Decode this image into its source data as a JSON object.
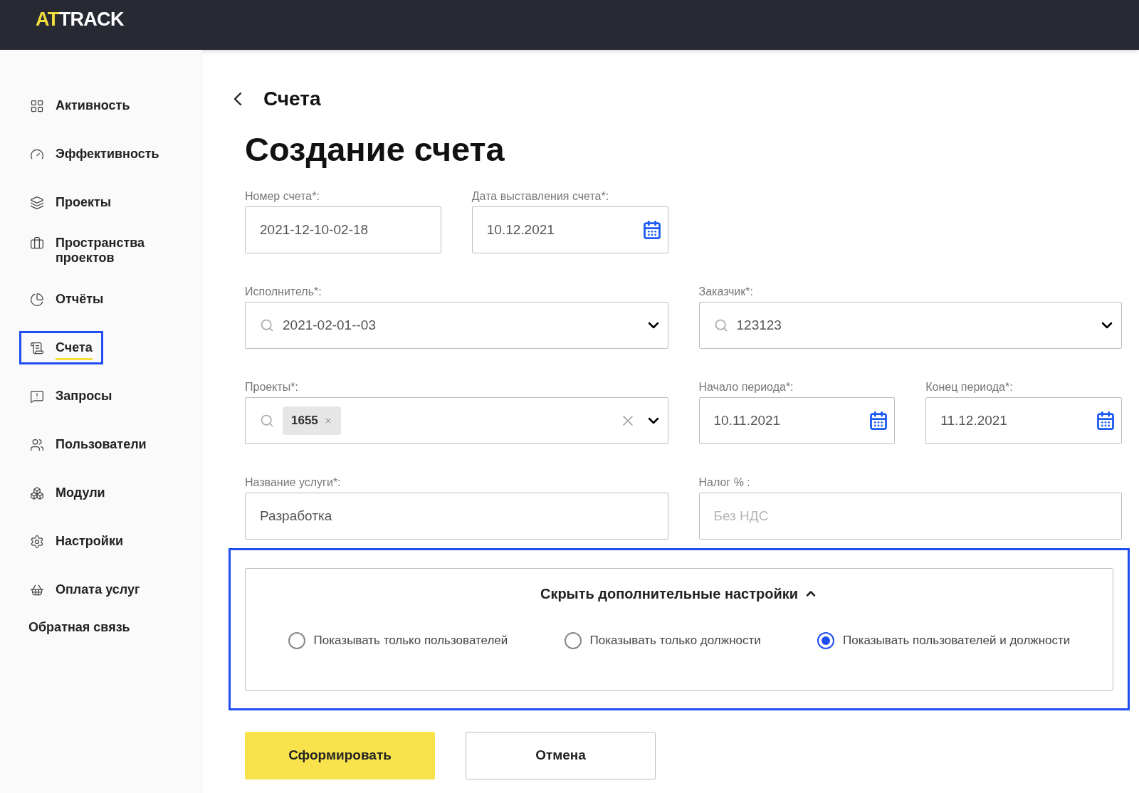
{
  "header": {
    "logo_accent": "AT",
    "logo_rest": "TRACK"
  },
  "sidebar": {
    "items": [
      {
        "label": "Активность",
        "selected": false,
        "annotated": false
      },
      {
        "label": "Эффективность",
        "selected": false,
        "annotated": false
      },
      {
        "label": "Проекты",
        "selected": false,
        "annotated": false
      },
      {
        "label": "Пространства проектов",
        "selected": false,
        "annotated": false
      },
      {
        "label": "Отчёты",
        "selected": false,
        "annotated": false
      },
      {
        "label": "Счета",
        "selected": true,
        "annotated": true
      },
      {
        "label": "Запросы",
        "selected": false,
        "annotated": false
      },
      {
        "label": "Пользователи",
        "selected": false,
        "annotated": false
      },
      {
        "label": "Модули",
        "selected": false,
        "annotated": false
      },
      {
        "label": "Настройки",
        "selected": false,
        "annotated": false
      },
      {
        "label": "Оплата услуг",
        "selected": false,
        "annotated": false
      }
    ],
    "feedback_link": "Обратная связь"
  },
  "page": {
    "back_title": "Счета",
    "heading": "Создание счета"
  },
  "form_rows": [
    [
      {
        "kind": "text",
        "label": "Номер счета*:",
        "value": "2021-12-10-02-18"
      },
      {
        "kind": "date",
        "label": "Дата выставления счета*:",
        "value": "10.12.2021"
      }
    ],
    [
      {
        "kind": "select",
        "label": "Исполнитель*:",
        "value": "2021-02-01--03"
      },
      {
        "kind": "select",
        "label": "Заказчик*:",
        "value": "123123"
      }
    ],
    [
      {
        "kind": "multiselect",
        "label": "Проекты*:",
        "tags": [
          "1655"
        ]
      },
      {
        "kind": "date",
        "label": "Начало периода*:",
        "value": "10.11.2021"
      },
      {
        "kind": "date",
        "label": "Конец периода*:",
        "value": "11.12.2021"
      }
    ],
    [
      {
        "kind": "text",
        "label": "Название услуги*:",
        "value": "Разработка"
      },
      {
        "kind": "text",
        "label": "Налог % :",
        "placeholder": "Без НДС"
      }
    ]
  ],
  "advanced": {
    "toggle": "Скрыть дополнительные настройки",
    "expanded": true,
    "annotated": true,
    "options": [
      {
        "label": "Показывать только пользователей",
        "selected": false
      },
      {
        "label": "Показывать только должности",
        "selected": false
      },
      {
        "label": "Показывать пользователей и должности",
        "selected": true
      }
    ]
  },
  "buttons": [
    {
      "kind": "primary",
      "label": "Сформировать"
    },
    {
      "kind": "secondary",
      "label": "Отмена"
    }
  ]
}
